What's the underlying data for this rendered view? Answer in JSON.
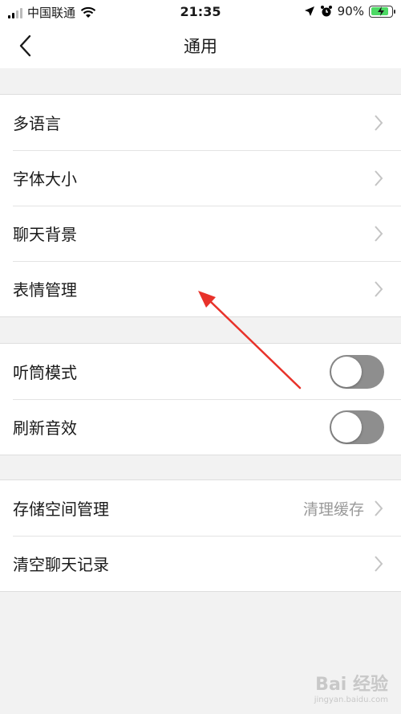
{
  "status_bar": {
    "carrier": "中国联通",
    "time": "21:35",
    "battery_percent": "90%",
    "battery_level": 0.9,
    "icons": [
      "signal-icon",
      "wifi-icon",
      "location-icon",
      "alarm-icon",
      "battery-charging-icon"
    ]
  },
  "nav": {
    "title": "通用",
    "back_icon": "back-chevron-icon"
  },
  "groups": [
    {
      "rows": [
        {
          "label": "多语言",
          "control": "chevron"
        },
        {
          "label": "字体大小",
          "control": "chevron"
        },
        {
          "label": "聊天背景",
          "control": "chevron"
        },
        {
          "label": "表情管理",
          "control": "chevron"
        }
      ]
    },
    {
      "rows": [
        {
          "label": "听筒模式",
          "control": "toggle",
          "on": false
        },
        {
          "label": "刷新音效",
          "control": "toggle",
          "on": false
        }
      ]
    },
    {
      "rows": [
        {
          "label": "存储空间管理",
          "value": "清理缓存",
          "control": "chevron"
        },
        {
          "label": "清空聊天记录",
          "control": "chevron"
        }
      ]
    }
  ],
  "annotation": {
    "type": "arrow",
    "color": "#e8322a",
    "points_to": "表情管理"
  },
  "watermark": {
    "main": "Bai 经验",
    "sub": "jingyan.baidu.com"
  },
  "colors": {
    "toggle_off": "#8e8e8e",
    "background": "#f2f2f2",
    "battery_fill": "#4cd964"
  }
}
